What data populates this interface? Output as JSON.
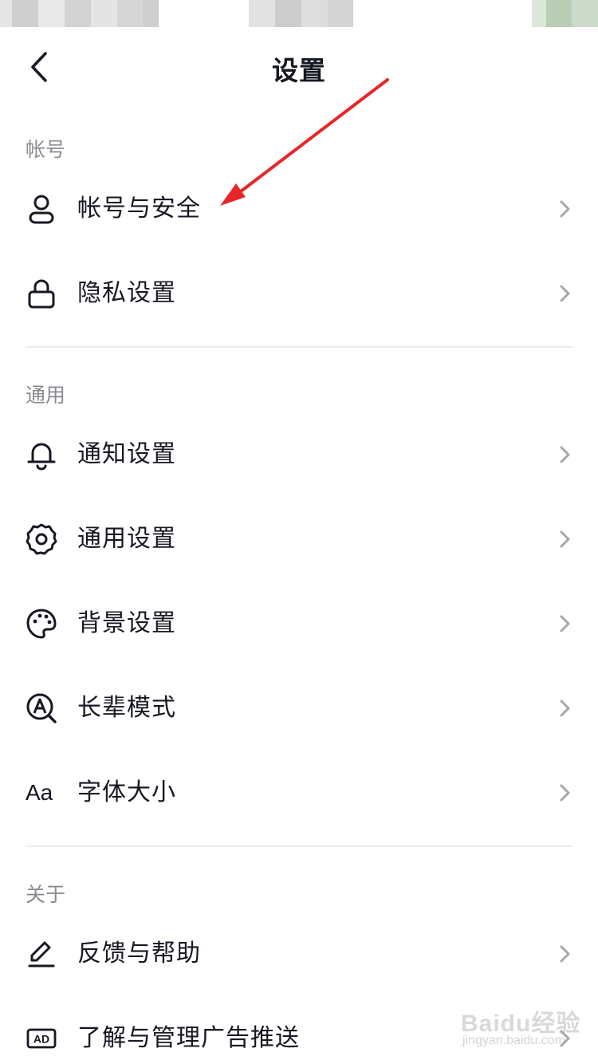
{
  "header": {
    "title": "设置"
  },
  "sections": [
    {
      "title": "帐号",
      "items": [
        {
          "label": "帐号与安全",
          "icon": "user-icon"
        },
        {
          "label": "隐私设置",
          "icon": "lock-icon"
        }
      ]
    },
    {
      "title": "通用",
      "items": [
        {
          "label": "通知设置",
          "icon": "bell-icon"
        },
        {
          "label": "通用设置",
          "icon": "gear-icon"
        },
        {
          "label": "背景设置",
          "icon": "palette-icon"
        },
        {
          "label": "长辈模式",
          "icon": "elder-mode-icon"
        },
        {
          "label": "字体大小",
          "icon": "font-size-icon",
          "icon_text": "Aa"
        }
      ]
    },
    {
      "title": "关于",
      "items": [
        {
          "label": "反馈与帮助",
          "icon": "pencil-icon"
        },
        {
          "label": "了解与管理广告推送",
          "icon": "ad-icon",
          "icon_text": "AD"
        }
      ]
    }
  ],
  "watermark": {
    "main": "Baidu经验",
    "sub": "jingyan.baidu.com"
  },
  "colors": {
    "text": "#161823",
    "section_header": "#8a8b91",
    "divider": "#ececee",
    "chevron": "#a6a7ab",
    "annotation_arrow": "#e8262a"
  }
}
